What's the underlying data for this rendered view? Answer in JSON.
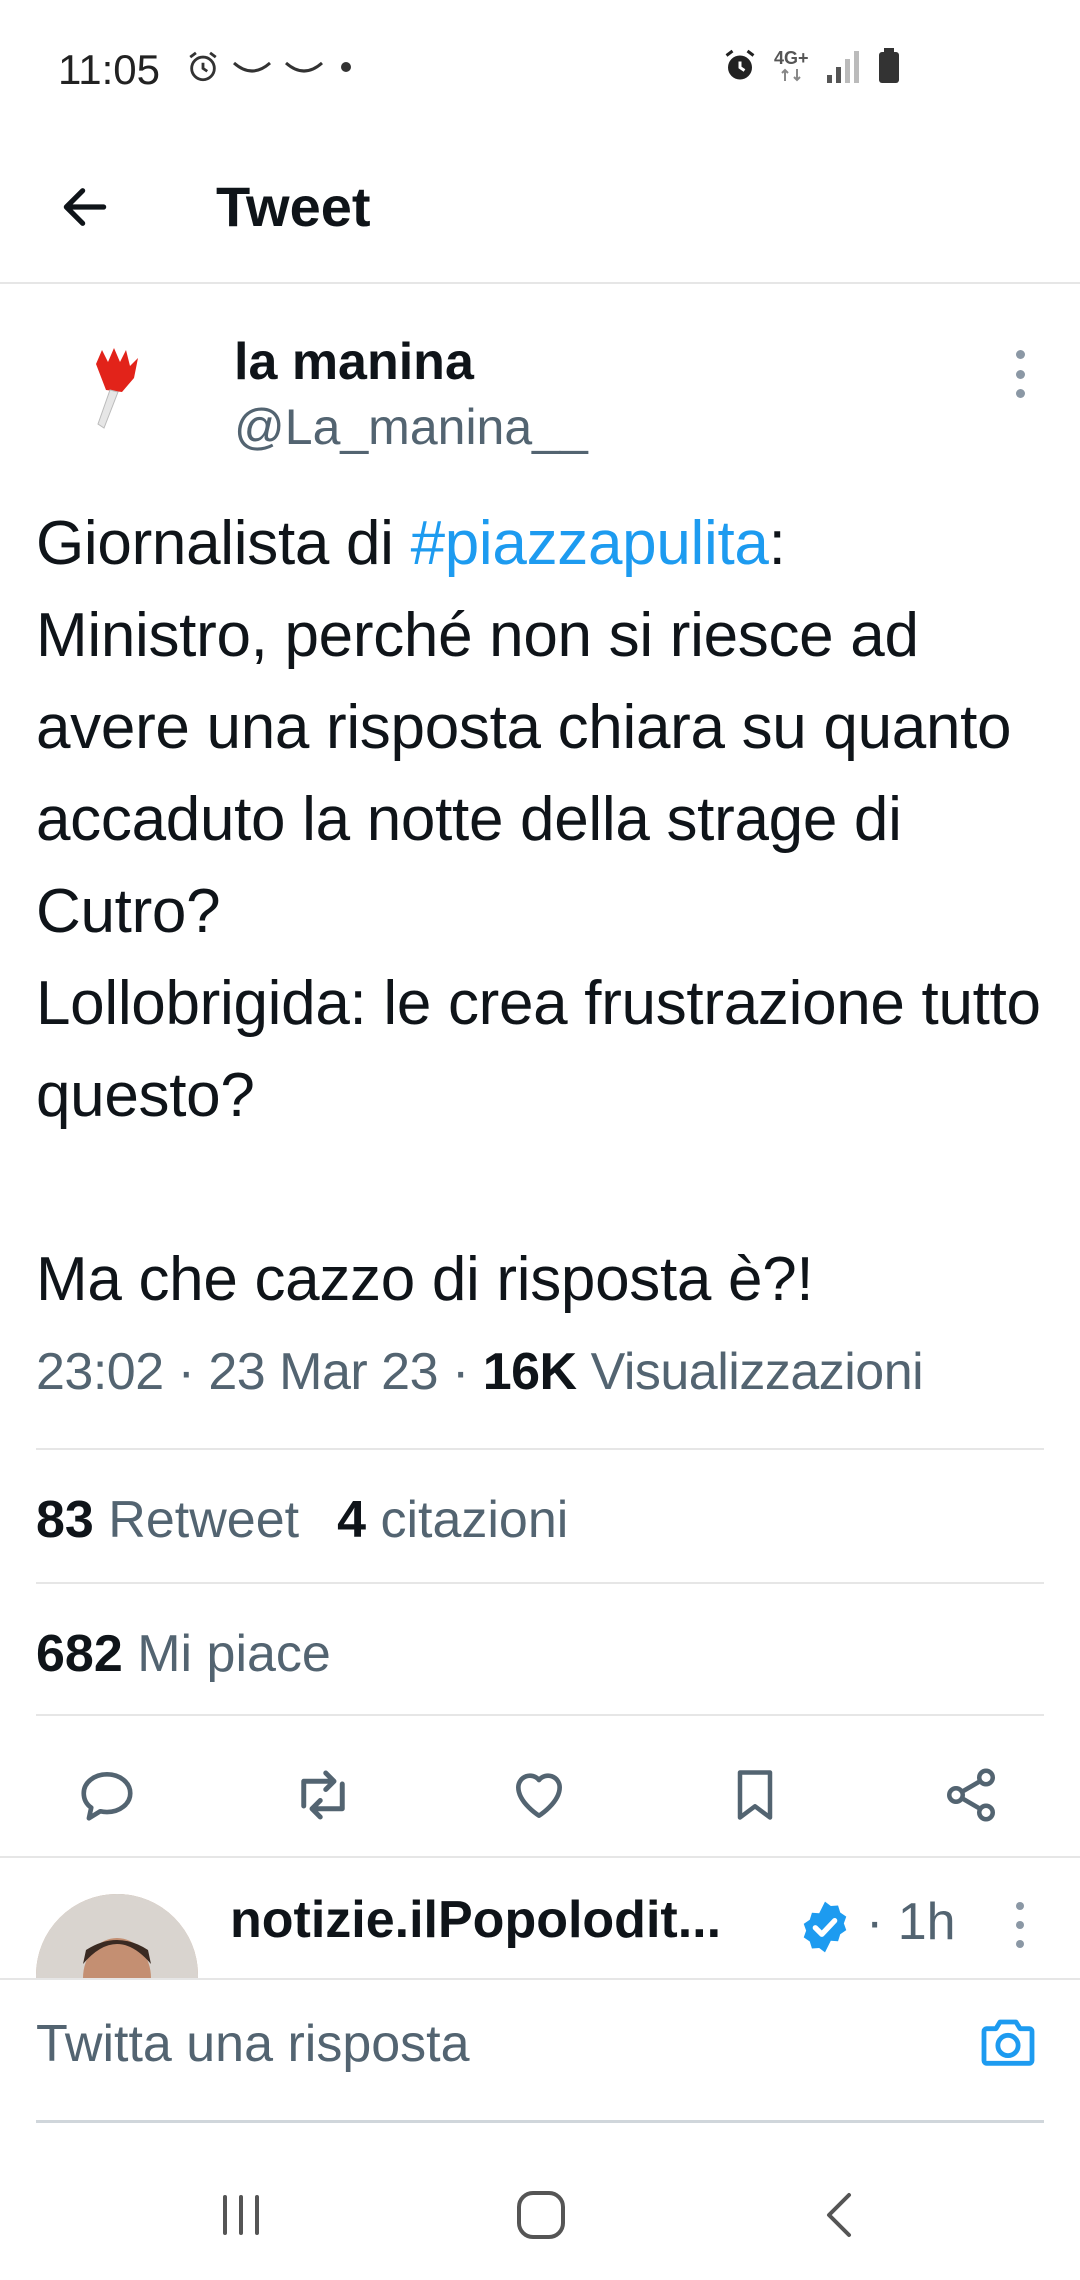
{
  "status_bar": {
    "time": "11:05",
    "network": "4G+",
    "left_icons": [
      "alarm-icon",
      "notification-icon",
      "notification-icon",
      "dot-icon"
    ],
    "right_icons": [
      "alarm-icon",
      "network-icon",
      "signal-icon",
      "battery-icon"
    ]
  },
  "header": {
    "back_icon": "arrow-left-icon",
    "title": "Tweet"
  },
  "tweet": {
    "author_name": "la manina",
    "author_handle": "@La_manina__",
    "text_before_hashtag": "Giornalista di ",
    "hashtag": "#piazzapulita",
    "text_after_hashtag": ":\nMinistro, perché non si riesce ad avere una risposta chiara su quanto accaduto la notte della strage di Cutro?\nLollobrigida: le crea frustrazione tutto questo?\n\nMa che cazzo di risposta è?!",
    "time": "23:02",
    "date": "23 Mar 23",
    "views_count": "16K",
    "views_label": "Visualizzazioni",
    "retweets_count": "83",
    "retweets_label": "Retweet",
    "quotes_count": "4",
    "quotes_label": "citazioni",
    "likes_count": "682",
    "likes_label": "Mi piace",
    "sep": " · "
  },
  "actions": [
    "reply-icon",
    "retweet-icon",
    "like-icon",
    "bookmark-icon",
    "share-icon"
  ],
  "reply_preview": {
    "name": "notizie.ilPopolodit...",
    "time": "1h",
    "sep": " · "
  },
  "compose": {
    "placeholder": "Twitta una risposta",
    "camera_icon": "camera-icon"
  },
  "nav": [
    "recent-apps-icon",
    "home-icon",
    "back-icon"
  ],
  "colors": {
    "accent": "#1d9bf0",
    "text_primary": "#0f1419",
    "text_secondary": "#536471",
    "divider": "#e6e6e6"
  }
}
